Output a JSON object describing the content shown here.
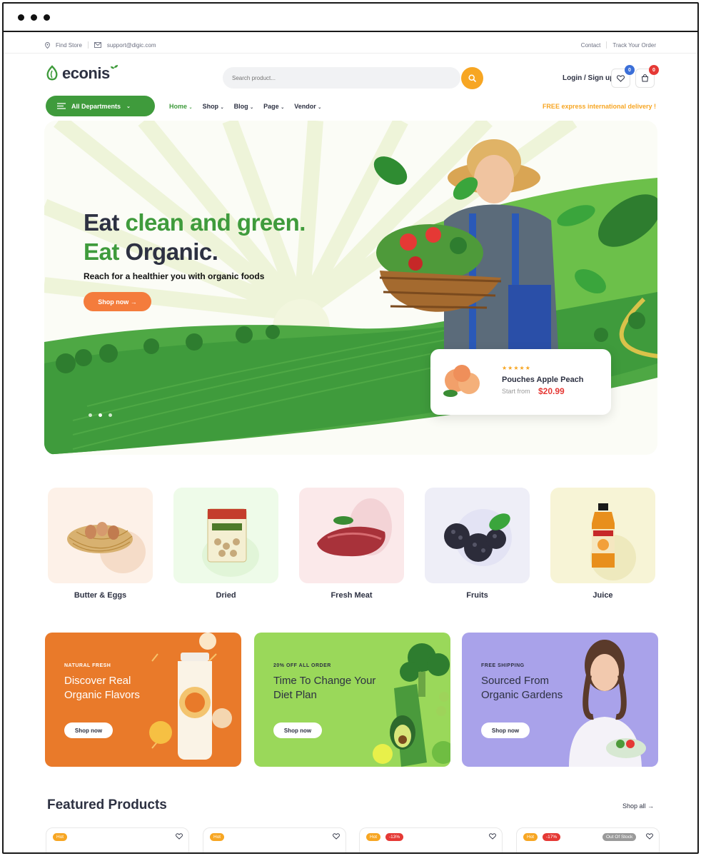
{
  "topbar": {
    "find_store": "Find Store",
    "email": "support@digic.com",
    "contact": "Contact",
    "track": "Track Your Order"
  },
  "header": {
    "logo": "econis",
    "search_placeholder": "Search product...",
    "login": "Login / Sign up",
    "wishlist_count": "0",
    "cart_count": "0"
  },
  "nav": {
    "departments": "All Departments",
    "items": [
      "Home",
      "Shop",
      "Blog",
      "Page",
      "Vendor"
    ],
    "promo": "FREE express international delivery !"
  },
  "hero": {
    "line1_a": "Eat ",
    "line1_b": "clean and green.",
    "line2_a": "Eat ",
    "line2_b": "Organic.",
    "subtitle": "Reach for a healthier you with organic foods",
    "cta": "Shop now →"
  },
  "hero_product": {
    "stars": "★★★★★",
    "name": "Pouches Apple Peach",
    "start_label": "Start from",
    "price": "$20.99"
  },
  "categories": [
    "Butter & Eggs",
    "Dried",
    "Fresh Meat",
    "Fruits",
    "Juice"
  ],
  "banners": [
    {
      "eyebrow": "NATURAL FRESH",
      "title": "Discover Real Organic Flavors",
      "cta": "Shop now"
    },
    {
      "eyebrow": "20% OFF ALL ORDER",
      "title": "Time To Change Your Diet Plan",
      "cta": "Shop now"
    },
    {
      "eyebrow": "FREE SHIPPING",
      "title": "Sourced From Organic Gardens",
      "cta": "Shop now"
    }
  ],
  "featured": {
    "title": "Featured Products",
    "shop_all": "Shop all →"
  },
  "products": [
    {
      "hot": "Hot",
      "discount": "",
      "stock": ""
    },
    {
      "hot": "Hot",
      "discount": "",
      "stock": ""
    },
    {
      "hot": "Hot",
      "discount": "-13%",
      "stock": ""
    },
    {
      "hot": "Hot",
      "discount": "-17%",
      "stock": "Out Of Stock"
    }
  ],
  "colors": {
    "brand_green": "#3f9b3c",
    "accent_orange": "#f7a623",
    "cta_orange": "#f47c3c",
    "price_red": "#e53935"
  }
}
